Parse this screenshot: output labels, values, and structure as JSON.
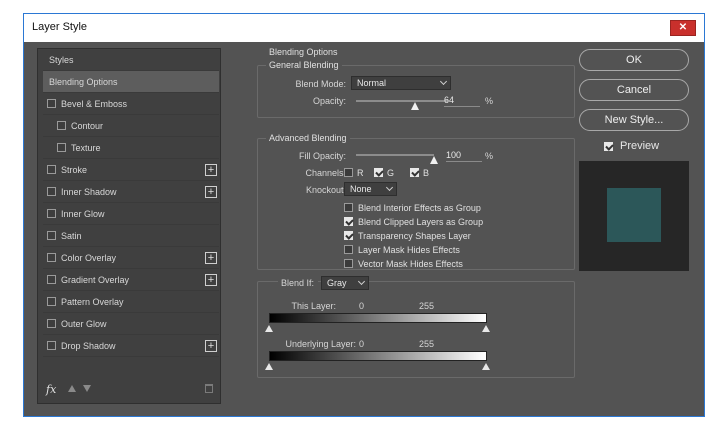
{
  "window": {
    "title": "Layer Style",
    "close_label": "✕"
  },
  "left_panel": {
    "items": [
      {
        "label": "Styles",
        "checkbox": false,
        "plus": false,
        "active": false,
        "indent": 0
      },
      {
        "label": "Blending Options",
        "checkbox": false,
        "plus": false,
        "active": true,
        "indent": 0
      },
      {
        "label": "Bevel & Emboss",
        "checkbox": true,
        "plus": false,
        "active": false,
        "indent": 0
      },
      {
        "label": "Contour",
        "checkbox": true,
        "plus": false,
        "active": false,
        "indent": 1
      },
      {
        "label": "Texture",
        "checkbox": true,
        "plus": false,
        "active": false,
        "indent": 1
      },
      {
        "label": "Stroke",
        "checkbox": true,
        "plus": true,
        "active": false,
        "indent": 0
      },
      {
        "label": "Inner Shadow",
        "checkbox": true,
        "plus": true,
        "active": false,
        "indent": 0
      },
      {
        "label": "Inner Glow",
        "checkbox": true,
        "plus": false,
        "active": false,
        "indent": 0
      },
      {
        "label": "Satin",
        "checkbox": true,
        "plus": false,
        "active": false,
        "indent": 0
      },
      {
        "label": "Color Overlay",
        "checkbox": true,
        "plus": true,
        "active": false,
        "indent": 0
      },
      {
        "label": "Gradient Overlay",
        "checkbox": true,
        "plus": true,
        "active": false,
        "indent": 0
      },
      {
        "label": "Pattern Overlay",
        "checkbox": true,
        "plus": false,
        "active": false,
        "indent": 0
      },
      {
        "label": "Outer Glow",
        "checkbox": true,
        "plus": false,
        "active": false,
        "indent": 0
      },
      {
        "label": "Drop Shadow",
        "checkbox": true,
        "plus": true,
        "active": false,
        "indent": 0
      }
    ],
    "footer": {
      "fx_label": "fx",
      "icons": [
        "fx-icon",
        "arrow-up-icon",
        "arrow-down-icon",
        "trash-icon"
      ]
    }
  },
  "blending": {
    "section_title": "Blending Options",
    "general": {
      "title": "General Blending",
      "blend_mode_label": "Blend Mode:",
      "blend_mode_value": "Normal",
      "opacity_label": "Opacity:",
      "opacity_value": "64",
      "opacity_unit": "%",
      "opacity_level": 0.64
    },
    "advanced": {
      "title": "Advanced Blending",
      "fill_opacity_label": "Fill Opacity:",
      "fill_opacity_value": "100",
      "fill_opacity_unit": "%",
      "fill_opacity_level": 1.0,
      "channels_label": "Channels:",
      "channels": [
        {
          "label": "R",
          "checked": false
        },
        {
          "label": "G",
          "checked": true
        },
        {
          "label": "B",
          "checked": true
        }
      ],
      "knockout_label": "Knockout:",
      "knockout_value": "None",
      "options": [
        {
          "label": "Blend Interior Effects as Group",
          "checked": false
        },
        {
          "label": "Blend Clipped Layers as Group",
          "checked": true
        },
        {
          "label": "Transparency Shapes Layer",
          "checked": true
        },
        {
          "label": "Layer Mask Hides Effects",
          "checked": false
        },
        {
          "label": "Vector Mask Hides Effects",
          "checked": false
        }
      ]
    },
    "blend_if": {
      "label": "Blend If:",
      "value": "Gray",
      "this_layer_label": "This Layer:",
      "this_layer_min": "0",
      "this_layer_max": "255",
      "underlying_label": "Underlying Layer:",
      "underlying_min": "0",
      "underlying_max": "255"
    }
  },
  "right": {
    "ok_label": "OK",
    "cancel_label": "Cancel",
    "new_style_label": "New Style...",
    "preview_label": "Preview",
    "preview_checked": true,
    "preview_color": "#2c5759"
  },
  "colors": {
    "panel": "#535353",
    "list_bg": "#404040",
    "accent": "#2b78d4"
  }
}
